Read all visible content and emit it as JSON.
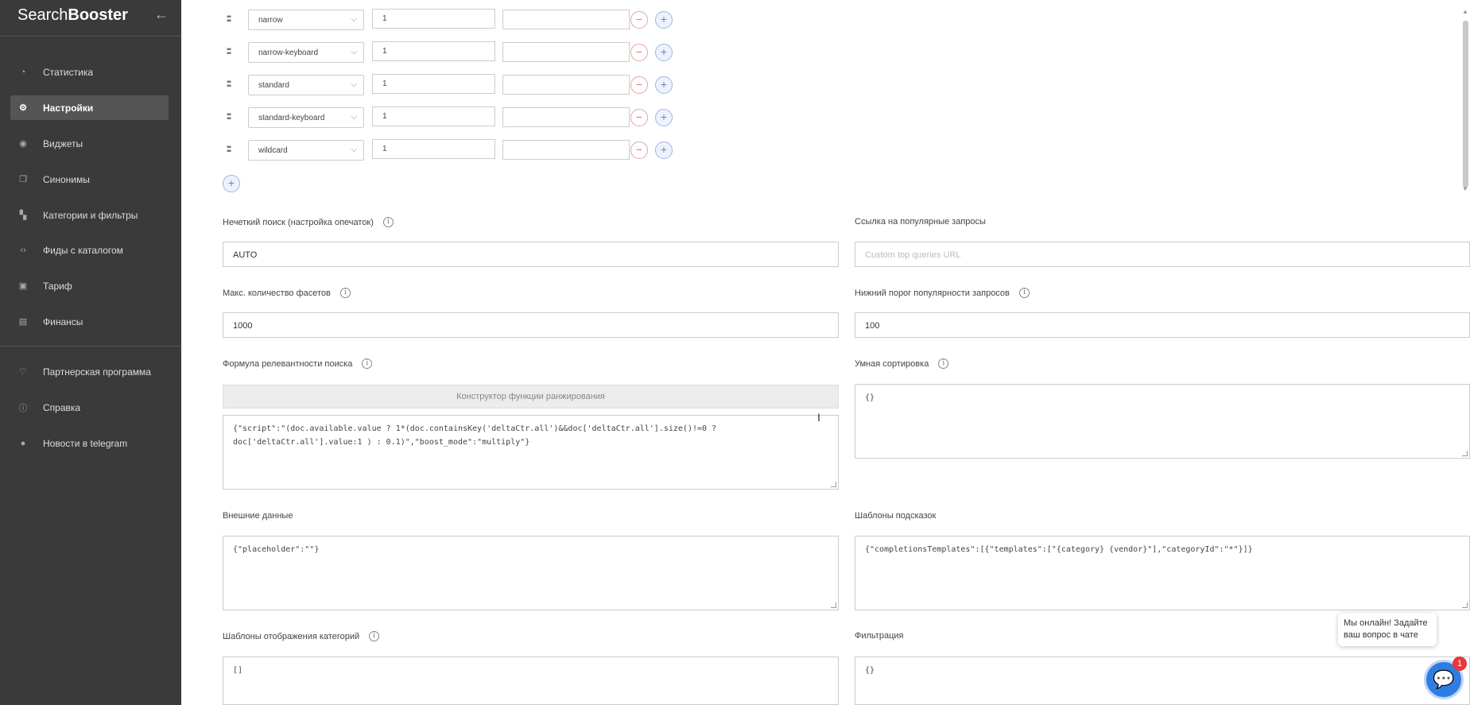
{
  "app": {
    "logo_light": "Search",
    "logo_bold": "Booster",
    "collapse_icon": "arrow-left-icon"
  },
  "sidebar": {
    "items": [
      {
        "label": "Статистика",
        "icon": "chart-icon",
        "active": false
      },
      {
        "label": "Настройки",
        "icon": "gear-icon",
        "active": true
      },
      {
        "label": "Виджеты",
        "icon": "eye-icon",
        "active": false
      },
      {
        "label": "Синонимы",
        "icon": "copy-icon",
        "active": false
      },
      {
        "label": "Категории и фильтры",
        "icon": "tree-icon",
        "active": false
      },
      {
        "label": "Фиды с каталогом",
        "icon": "code-icon",
        "active": false
      },
      {
        "label": "Тариф",
        "icon": "briefcase-icon",
        "active": false
      },
      {
        "label": "Финансы",
        "icon": "wallet-icon",
        "active": false
      }
    ],
    "secondary": [
      {
        "label": "Партнерская программа",
        "icon": "handshake-icon"
      },
      {
        "label": "Справка",
        "icon": "info-icon"
      },
      {
        "label": "Новости в telegram",
        "icon": "telegram-icon"
      }
    ]
  },
  "rules": [
    {
      "type": "narrow",
      "value": "1",
      "extra": ""
    },
    {
      "type": "narrow-keyboard",
      "value": "1",
      "extra": ""
    },
    {
      "type": "standard",
      "value": "1",
      "extra": ""
    },
    {
      "type": "standard-keyboard",
      "value": "1",
      "extra": ""
    },
    {
      "type": "wildcard",
      "value": "1",
      "extra": ""
    }
  ],
  "fields": {
    "fuzzy": {
      "label": "Нечеткий поиск (настройка опечаток)",
      "value": "AUTO"
    },
    "top_queries": {
      "label": "Ссылка на популярные запросы",
      "placeholder": "Custom top queries URL"
    },
    "max_facets": {
      "label": "Макс. количество фасетов",
      "value": "1000"
    },
    "popularity": {
      "label": "Нижний порог популярности запросов",
      "value": "100"
    },
    "formula": {
      "label": "Формула релевантности поиска",
      "constructor_label": "Конструктор функции ранжирования",
      "value": "{\"script\":\"(doc.available.value ? 1*(doc.containsKey('deltaCtr.all')&&doc['deltaCtr.all'].size()!=0 ?\ndoc['deltaCtr.all'].value:1 ) : 0.1)\",\"boost_mode\":\"multiply\"}"
    },
    "smart_sort": {
      "label": "Умная сортировка",
      "value": "{}"
    },
    "external": {
      "label": "Внешние данные",
      "value": "{\"placeholder\":\"\"}"
    },
    "hint_templates": {
      "label": "Шаблоны подсказок",
      "value": "{\"completionsTemplates\":[{\"templates\":[\"{category} {vendor}\"],\"categoryId\":\"*\"}]}"
    },
    "category_templates": {
      "label": "Шаблоны отображения категорий",
      "value": "[]"
    },
    "filtering": {
      "label": "Фильтрация",
      "value": "{}"
    }
  },
  "chat": {
    "message": "Мы онлайн! Задайте ваш вопрос в чате",
    "badge": "1"
  }
}
